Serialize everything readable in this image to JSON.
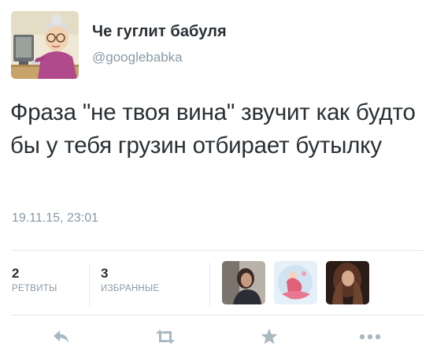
{
  "tweet": {
    "author_name": "Че гуглит бабуля",
    "author_handle": "@googlebabka",
    "text": "Фраза \"не твоя вина\" звучит как будто бы у тебя грузин отбирает бутылку",
    "timestamp": "19.11.15, 23:01"
  },
  "stats": {
    "retweets_count": "2",
    "retweets_label": "РЕТВИТЫ",
    "favorites_count": "3",
    "favorites_label": "ИЗБРАННЫЕ"
  },
  "favorited_by_avatars": [
    "user-avatar-1",
    "user-avatar-2",
    "user-avatar-3"
  ],
  "actions": [
    "reply-icon",
    "retweet-icon",
    "favorite-star-icon",
    "more-dots-icon"
  ],
  "colors": {
    "text": "#292f33",
    "secondary": "#8899a6",
    "icon": "#aab8c2",
    "divider": "#e1e8ed"
  }
}
